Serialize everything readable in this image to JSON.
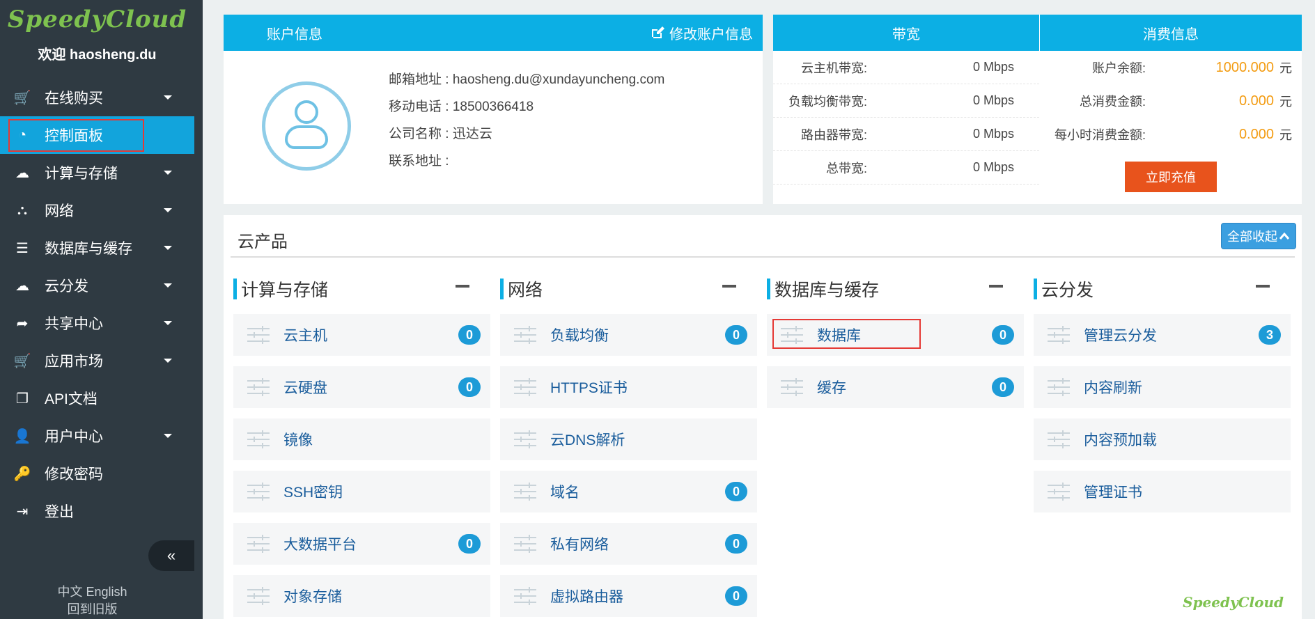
{
  "brand": {
    "logo": "SpeedyCloud",
    "welcome": "欢迎 haosheng.du"
  },
  "sidebar": {
    "items": [
      {
        "label": "在线购买",
        "icon": "cart-icon",
        "glyph": "🛒",
        "caret": true
      },
      {
        "label": "控制面板",
        "icon": "dashboard-icon",
        "glyph": "◔",
        "caret": false,
        "active": true
      },
      {
        "label": "计算与存储",
        "icon": "cloud-icon",
        "glyph": "☁",
        "caret": true
      },
      {
        "label": "网络",
        "icon": "sitemap-icon",
        "glyph": "⛬",
        "caret": true
      },
      {
        "label": "数据库与缓存",
        "icon": "database-icon",
        "glyph": "☰",
        "caret": true
      },
      {
        "label": "云分发",
        "icon": "cloud-upload-icon",
        "glyph": "☁",
        "caret": true
      },
      {
        "label": "共享中心",
        "icon": "share-icon",
        "glyph": "➦",
        "caret": true
      },
      {
        "label": "应用市场",
        "icon": "cart-icon",
        "glyph": "🛒",
        "caret": true
      },
      {
        "label": "API文档",
        "icon": "docs-icon",
        "glyph": "❐",
        "caret": false
      },
      {
        "label": "用户中心",
        "icon": "user-icon",
        "glyph": "👤",
        "caret": true
      },
      {
        "label": "修改密码",
        "icon": "key-icon",
        "glyph": "🔑",
        "caret": false
      },
      {
        "label": "登出",
        "icon": "logout-icon",
        "glyph": "⇥",
        "caret": false
      }
    ],
    "collapse_glyph": "«",
    "lang": "中文   English",
    "old_version": "回到旧版"
  },
  "account": {
    "title": "账户信息",
    "edit_label": "修改账户信息",
    "email": "邮箱地址 : haosheng.du@xundayuncheng.com",
    "phone": "移动电话 : 18500366418",
    "company": "公司名称 : 迅达云",
    "address": "联系地址 :"
  },
  "bandwidth": {
    "title": "带宽",
    "rows": [
      {
        "k": "云主机带宽:",
        "v": "0 Mbps"
      },
      {
        "k": "负载均衡带宽:",
        "v": "0 Mbps"
      },
      {
        "k": "路由器带宽:",
        "v": "0 Mbps"
      },
      {
        "k": "总带宽:",
        "v": "0 Mbps"
      }
    ]
  },
  "billing": {
    "title": "消费信息",
    "rows": [
      {
        "k": "账户余额:",
        "v": "1000.000",
        "unit": "元"
      },
      {
        "k": "总消费金额:",
        "v": "0.000",
        "unit": "元"
      },
      {
        "k": "每小时消费金额:",
        "v": "0.000",
        "unit": "元"
      }
    ],
    "recharge": "立即充值"
  },
  "products": {
    "title": "云产品",
    "collapse_all": "全部收起",
    "collapse_glyph": "⌃",
    "columns": [
      {
        "title": "计算与存储",
        "items": [
          {
            "label": "云主机",
            "badge": "0"
          },
          {
            "label": "云硬盘",
            "badge": "0"
          },
          {
            "label": "镜像",
            "badge": ""
          },
          {
            "label": "SSH密钥",
            "badge": ""
          },
          {
            "label": "大数据平台",
            "badge": "0"
          },
          {
            "label": "对象存储",
            "badge": ""
          }
        ]
      },
      {
        "title": "网络",
        "items": [
          {
            "label": "负载均衡",
            "badge": "0"
          },
          {
            "label": "HTTPS证书",
            "badge": ""
          },
          {
            "label": "云DNS解析",
            "badge": ""
          },
          {
            "label": "域名",
            "badge": "0"
          },
          {
            "label": "私有网络",
            "badge": "0"
          },
          {
            "label": "虚拟路由器",
            "badge": "0"
          }
        ]
      },
      {
        "title": "数据库与缓存",
        "items": [
          {
            "label": "数据库",
            "badge": "0",
            "highlight": true
          },
          {
            "label": "缓存",
            "badge": "0"
          }
        ]
      },
      {
        "title": "云分发",
        "items": [
          {
            "label": "管理云分发",
            "badge": "3"
          },
          {
            "label": "内容刷新",
            "badge": ""
          },
          {
            "label": "内容预加载",
            "badge": ""
          },
          {
            "label": "管理证书",
            "badge": ""
          }
        ]
      }
    ]
  },
  "colors": {
    "accent": "#0cafe4",
    "sidebar": "#2f3a42",
    "orange": "#e8531c",
    "amount": "#f39c12"
  }
}
